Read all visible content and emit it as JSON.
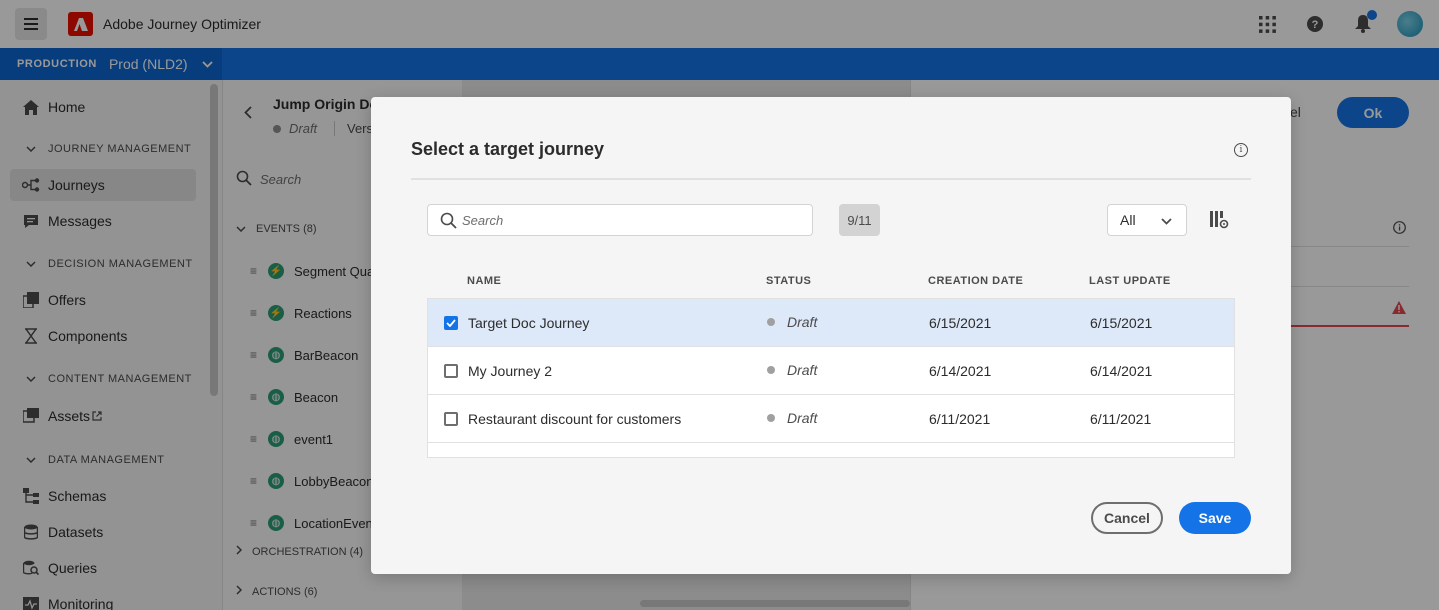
{
  "app": {
    "title": "Adobe Journey Optimizer"
  },
  "env": {
    "label": "PRODUCTION",
    "value": "Prod (NLD2)"
  },
  "nav": {
    "home": "Home",
    "sections": {
      "journey_management": "JOURNEY MANAGEMENT",
      "decision_management": "DECISION MANAGEMENT",
      "content_management": "CONTENT MANAGEMENT",
      "data_management": "DATA MANAGEMENT"
    },
    "items": {
      "journeys": "Journeys",
      "messages": "Messages",
      "offers": "Offers",
      "components": "Components",
      "assets": "Assets",
      "schemas": "Schemas",
      "datasets": "Datasets",
      "queries": "Queries",
      "monitoring": "Monitoring"
    }
  },
  "journey": {
    "title": "Jump Origin Do",
    "status": "Draft",
    "version": "Vers"
  },
  "palette": {
    "search_placeholder": "Search",
    "events_header": "EVENTS (8)",
    "events": [
      "Segment Qua",
      "Reactions",
      "BarBeacon",
      "Beacon",
      "event1",
      "LobbyBeacon",
      "LocationEven"
    ],
    "orchestration_header": "ORCHESTRATION (4)",
    "actions_header": "ACTIONS (6)"
  },
  "right_panel": {
    "cancel": "cel",
    "ok": "Ok"
  },
  "modal": {
    "title": "Select a target journey",
    "search_placeholder": "Search",
    "count": "9/11",
    "filter_value": "All",
    "columns": {
      "name": "NAME",
      "status": "STATUS",
      "creation_date": "CREATION DATE",
      "last_update": "LAST UPDATE"
    },
    "rows": [
      {
        "name": "Target Doc Journey",
        "status": "Draft",
        "creation_date": "6/15/2021",
        "last_update": "6/15/2021",
        "selected": true
      },
      {
        "name": "My Journey 2",
        "status": "Draft",
        "creation_date": "6/14/2021",
        "last_update": "6/14/2021",
        "selected": false
      },
      {
        "name": "Restaurant discount for customers",
        "status": "Draft",
        "creation_date": "6/11/2021",
        "last_update": "6/11/2021",
        "selected": false
      }
    ],
    "cancel_label": "Cancel",
    "save_label": "Save"
  },
  "colors": {
    "accent": "#1473e6",
    "env_bar": "#0d66d0",
    "adobe_red": "#eb1000",
    "selected_row": "#dde8f8",
    "warning": "#e34850"
  },
  "icons": [
    "hamburger-icon",
    "adobe-logo-icon",
    "apps-grid-icon",
    "help-icon",
    "bell-icon",
    "avatar",
    "home-icon",
    "journeys-icon",
    "messages-icon",
    "offers-icon",
    "components-icon",
    "assets-icon",
    "external-link-icon",
    "schemas-icon",
    "datasets-icon",
    "queries-icon",
    "monitoring-icon",
    "search-icon",
    "info-icon",
    "chevron-down-icon",
    "column-settings-icon",
    "checkbox-icon",
    "warning-icon"
  ]
}
